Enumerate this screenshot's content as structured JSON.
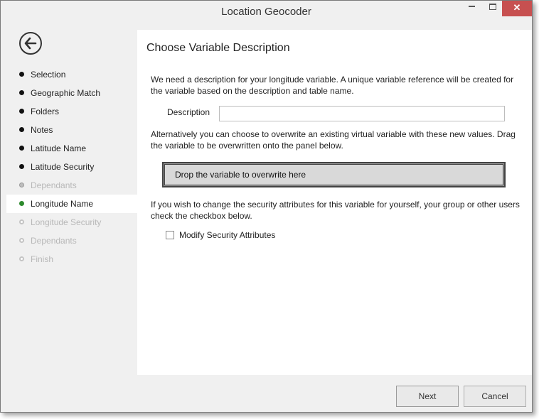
{
  "window": {
    "title": "Location Geocoder"
  },
  "titlebar": {
    "minimize": "minimize",
    "maximize": "maximize",
    "close": "close"
  },
  "sidebar": {
    "steps": [
      {
        "label": "Selection",
        "state": "done"
      },
      {
        "label": "Geographic Match",
        "state": "done"
      },
      {
        "label": "Folders",
        "state": "done"
      },
      {
        "label": "Notes",
        "state": "done"
      },
      {
        "label": "Latitude Name",
        "state": "done"
      },
      {
        "label": "Latitude Security",
        "state": "done"
      },
      {
        "label": "Dependants",
        "state": "skipped"
      },
      {
        "label": "Longitude Name",
        "state": "current"
      },
      {
        "label": "Longitude Security",
        "state": "pending"
      },
      {
        "label": "Dependants",
        "state": "pending"
      },
      {
        "label": "Finish",
        "state": "pending"
      }
    ]
  },
  "main": {
    "title": "Choose Variable Description",
    "intro": "We need a description for your longitude variable.  A unique variable reference will be created for the variable based on the description and table name.",
    "description_label": "Description",
    "description_value": "",
    "overwrite_text": "Alternatively you can choose to overwrite an existing virtual variable with these new values. Drag the variable to be overwritten onto the panel below.",
    "drop_label": "Drop the variable to overwrite here",
    "security_text": "If you wish to change the security attributes for this variable for yourself, your group or other users check the checkbox below.",
    "modify_security_label": "Modify Security Attributes",
    "modify_security_checked": false
  },
  "footer": {
    "next_label": "Next",
    "cancel_label": "Cancel"
  },
  "colors": {
    "close_button": "#c75050",
    "current_step_dot": "#2d8a2d",
    "content_bg": "#ffffff",
    "chrome_bg": "#f0f0f0"
  }
}
